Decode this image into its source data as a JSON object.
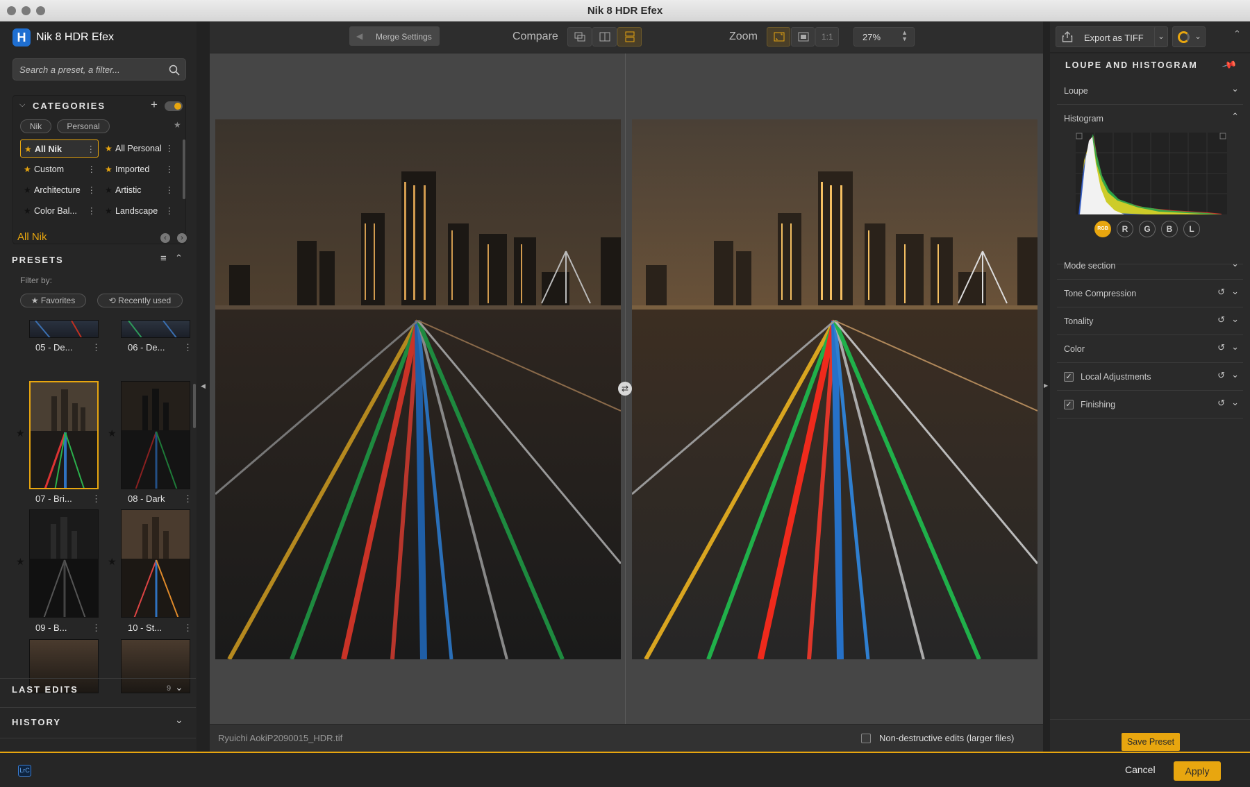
{
  "window": {
    "title": "Nik 8 HDR Efex"
  },
  "app": {
    "name": "Nik 8 HDR Efex",
    "logo_letter": "H"
  },
  "search": {
    "placeholder": "Search a preset, a filter..."
  },
  "categories": {
    "title": "CATEGORIES",
    "filters": [
      "Nik",
      "Personal"
    ],
    "items": [
      {
        "label": "All Nik",
        "starred": true,
        "selected": true
      },
      {
        "label": "All Personal",
        "starred": true,
        "selected": false
      },
      {
        "label": "Custom",
        "starred": true,
        "selected": false
      },
      {
        "label": "Imported",
        "starred": true,
        "selected": false
      },
      {
        "label": "Architecture",
        "starred": false,
        "selected": false
      },
      {
        "label": "Artistic",
        "starred": false,
        "selected": false
      },
      {
        "label": "Color Bal...",
        "starred": false,
        "selected": false
      },
      {
        "label": "Landscape",
        "starred": false,
        "selected": false
      }
    ]
  },
  "current_category": "All Nik",
  "presets": {
    "title": "PRESETS",
    "filter_by": "Filter by:",
    "filter_buttons": [
      "Favorites",
      "Recently used"
    ],
    "thumbs": [
      {
        "label": "05 - De..."
      },
      {
        "label": "06 - De..."
      },
      {
        "label": "07 - Bri...",
        "selected": true
      },
      {
        "label": "08 - Dark"
      },
      {
        "label": "09 - B..."
      },
      {
        "label": "10 - St..."
      }
    ]
  },
  "last_edits": {
    "title": "LAST EDITS",
    "count": "9"
  },
  "history": {
    "title": "HISTORY"
  },
  "toolbar": {
    "merge_settings": "Merge Settings",
    "compare_label": "Compare",
    "zoom_label": "Zoom",
    "zoom_one_to_one": "1:1",
    "zoom_value": "27%"
  },
  "status": {
    "filename": "Ryuichi AokiP2090015_HDR.tif",
    "nondestructive_label": "Non-destructive edits (larger files)"
  },
  "right": {
    "export_label": "Export as TIFF",
    "panel_title": "LOUPE AND HISTOGRAM",
    "sections": {
      "loupe": "Loupe",
      "histogram": "Histogram",
      "mode": "Mode section",
      "tone": "Tone Compression",
      "tonality": "Tonality",
      "color": "Color",
      "local": "Local Adjustments",
      "finishing": "Finishing"
    },
    "channels": [
      "RGB",
      "R",
      "G",
      "B",
      "L"
    ],
    "save_preset": "Save Preset"
  },
  "bottom": {
    "lrc_badge": "LrC",
    "cancel": "Cancel",
    "apply": "Apply"
  },
  "colors": {
    "accent": "#e8a60f",
    "logo_blue": "#1f6fd1"
  }
}
